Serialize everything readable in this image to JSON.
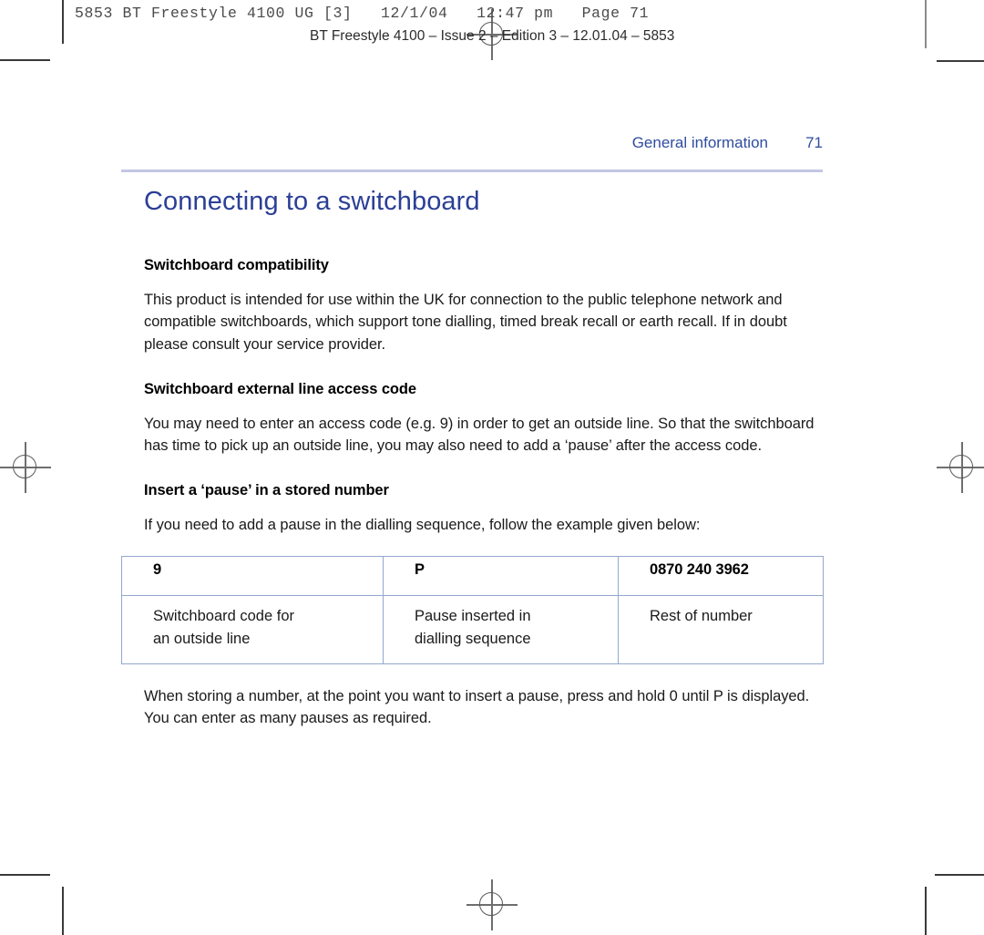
{
  "prepress": {
    "slug_line_1": "5853 BT Freestyle 4100 UG [3]   12/1/04   12:47 pm   Page 71",
    "slug_line_2": "BT Freestyle 4100 – Issue 2 – Edition 3 – 12.01.04 – 5853"
  },
  "running_head": {
    "section": "General information",
    "page_number": "71"
  },
  "page": {
    "title": "Connecting to a switchboard"
  },
  "sections": [
    {
      "heading": "Switchboard compatibility",
      "body": "This product is intended for use within the UK for connection to the public telephone network and compatible switchboards, which support tone dialling, timed break recall or earth recall. If in doubt please consult your service provider."
    },
    {
      "heading": "Switchboard external line access code",
      "body": "You may need to enter an access code (e.g. 9) in order to get an outside line. So that the switchboard has time to pick up an outside line, you may also need to add a ‘pause’ after the access code."
    },
    {
      "heading": "Insert a ‘pause’ in a stored number",
      "body": "If you need to add a pause in the dialling sequence, follow the example given below:"
    }
  ],
  "example_table": {
    "header_row": [
      "9",
      "P",
      "0870 240 3962"
    ],
    "description_row": [
      {
        "line1": "Switchboard code for",
        "line2": "an outside line"
      },
      {
        "line1": "Pause inserted in",
        "line2": "dialling sequence"
      },
      {
        "line1": "Rest of number",
        "line2": ""
      }
    ]
  },
  "closing_paragraph": "When storing a number, at the point you want to insert a pause, press and hold 0 until P is displayed. You can enter as many pauses as required.",
  "colors": {
    "title_blue": "#2b3f96",
    "running_head_blue": "#2f4da0",
    "rule_lavender": "#c3c6e2",
    "table_border_blue": "#93a7cf",
    "body_black": "#1a1a1a"
  }
}
